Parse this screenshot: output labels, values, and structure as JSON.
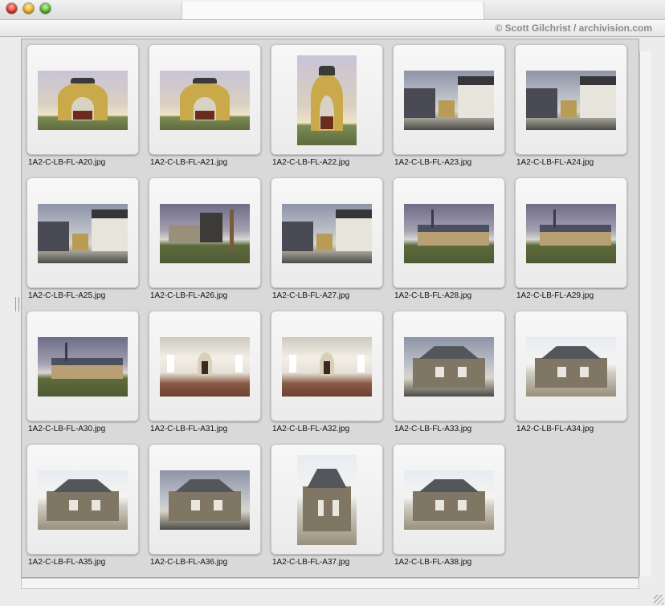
{
  "window": {
    "credit": "© Scott Gilchrist / archivision.com"
  },
  "thumbnails": [
    {
      "caption": "1A2-C-LB-FL-A20.jpg",
      "scene": "gate"
    },
    {
      "caption": "1A2-C-LB-FL-A21.jpg",
      "scene": "gate"
    },
    {
      "caption": "1A2-C-LB-FL-A22.jpg",
      "scene": "gate-portrait"
    },
    {
      "caption": "1A2-C-LB-FL-A23.jpg",
      "scene": "street"
    },
    {
      "caption": "1A2-C-LB-FL-A24.jpg",
      "scene": "street"
    },
    {
      "caption": "1A2-C-LB-FL-A25.jpg",
      "scene": "street"
    },
    {
      "caption": "1A2-C-LB-FL-A26.jpg",
      "scene": "yard"
    },
    {
      "caption": "1A2-C-LB-FL-A27.jpg",
      "scene": "village"
    },
    {
      "caption": "1A2-C-LB-FL-A28.jpg",
      "scene": "barracks"
    },
    {
      "caption": "1A2-C-LB-FL-A29.jpg",
      "scene": "barracks"
    },
    {
      "caption": "1A2-C-LB-FL-A30.jpg",
      "scene": "barracks"
    },
    {
      "caption": "1A2-C-LB-FL-A31.jpg",
      "scene": "interior"
    },
    {
      "caption": "1A2-C-LB-FL-A32.jpg",
      "scene": "interior"
    },
    {
      "caption": "1A2-C-LB-FL-A33.jpg",
      "scene": "houses"
    },
    {
      "caption": "1A2-C-LB-FL-A34.jpg",
      "scene": "house"
    },
    {
      "caption": "1A2-C-LB-FL-A35.jpg",
      "scene": "house"
    },
    {
      "caption": "1A2-C-LB-FL-A36.jpg",
      "scene": "houses"
    },
    {
      "caption": "1A2-C-LB-FL-A37.jpg",
      "scene": "house-portrait"
    },
    {
      "caption": "1A2-C-LB-FL-A38.jpg",
      "scene": "house"
    }
  ]
}
